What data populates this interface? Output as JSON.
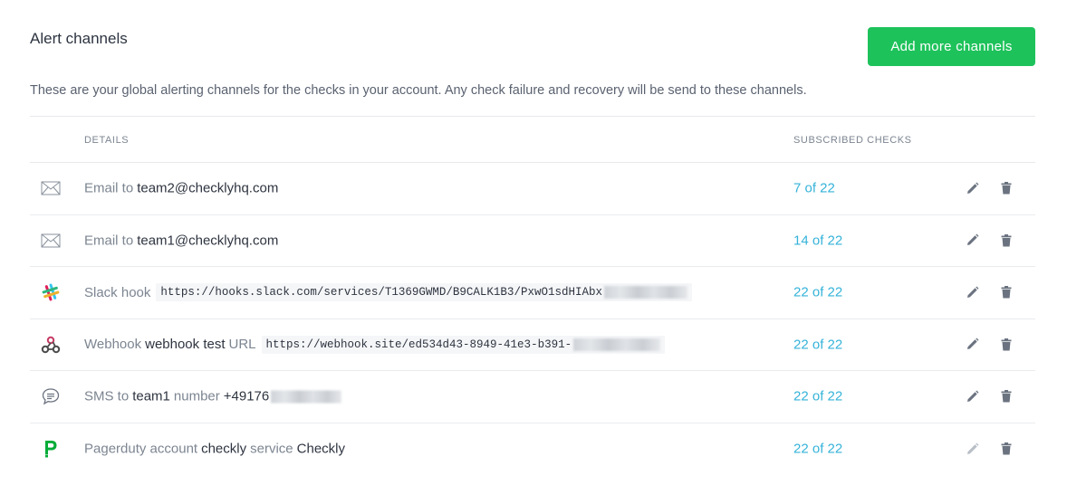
{
  "header": {
    "title": "Alert channels",
    "add_button": "Add more channels",
    "description": "These are your global alerting channels for the checks in your account. Any check failure and recovery will be send to these channels."
  },
  "table": {
    "columns": {
      "details": "DETAILS",
      "subscribed": "SUBSCRIBED CHECKS"
    },
    "rows": [
      {
        "type_icon": "envelope-icon",
        "type": "Email to",
        "target": "team2@checklyhq.com",
        "subscribed": "7 of 22"
      },
      {
        "type_icon": "envelope-icon",
        "type": "Email to",
        "target": "team1@checklyhq.com",
        "subscribed": "14 of 22"
      },
      {
        "type_icon": "slack-icon",
        "type": "Slack hook",
        "code": "https://hooks.slack.com/services/T1369GWMD/B9CALK1B3/PxwO1sdHIAbx",
        "subscribed": "22 of 22"
      },
      {
        "type_icon": "webhook-icon",
        "type": "Webhook",
        "name": "webhook test",
        "url_label": "URL",
        "code": "https://webhook.site/ed534d43-8949-41e3-b391-",
        "subscribed": "22 of 22"
      },
      {
        "type_icon": "sms-icon",
        "type": "SMS to",
        "target": "team1",
        "number_label": "number",
        "number": "+49176",
        "subscribed": "22 of 22"
      },
      {
        "type_icon": "pagerduty-icon",
        "type": "Pagerduty account",
        "account": "checkly",
        "service_label": "service",
        "service": "Checkly",
        "subscribed": "22 of 22"
      }
    ]
  },
  "colors": {
    "accent_green": "#1ec25b",
    "link_blue": "#35b3d9",
    "muted_text": "#7c8591"
  }
}
